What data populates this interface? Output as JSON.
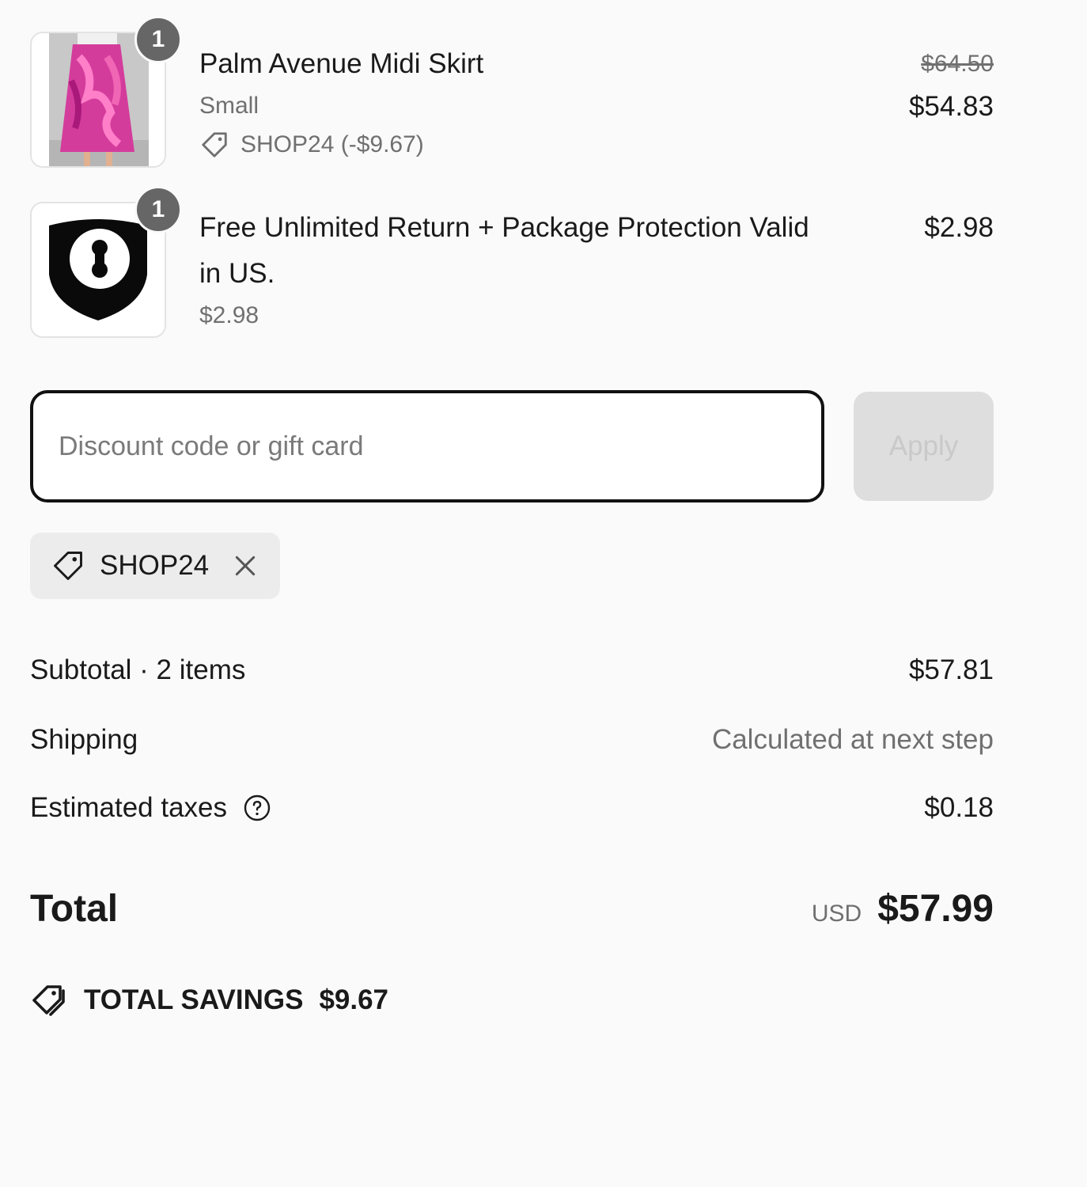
{
  "line_items": [
    {
      "quantity": "1",
      "title": "Palm Avenue Midi Skirt",
      "variant": "Small",
      "discount_text": "SHOP24 (-$9.67)",
      "original_price": "$64.50",
      "price": "$54.83",
      "thumbnail": "skirt-photo"
    },
    {
      "quantity": "1",
      "title_line1": "Free Unlimited Return + Package Protection Valid",
      "title_line2": "in US.",
      "subprice": "$2.98",
      "price": "$2.98",
      "thumbnail": "shield-keyhole-icon"
    }
  ],
  "discount": {
    "placeholder": "Discount code or gift card",
    "apply_label": "Apply",
    "applied_code": "SHOP24"
  },
  "totals": {
    "subtotal_label": "Subtotal · 2 items",
    "subtotal_value": "$57.81",
    "shipping_label": "Shipping",
    "shipping_value": "Calculated at next step",
    "taxes_label": "Estimated taxes",
    "taxes_value": "$0.18",
    "total_label": "Total",
    "currency": "USD",
    "total_value": "$57.99"
  },
  "savings": {
    "label": "TOTAL SAVINGS",
    "value": "$9.67"
  },
  "colors": {
    "background": "#fafafa",
    "text": "#1a1a1a",
    "muted": "#707070",
    "badge": "#666666",
    "skirt_pink": "#d43c9c"
  }
}
